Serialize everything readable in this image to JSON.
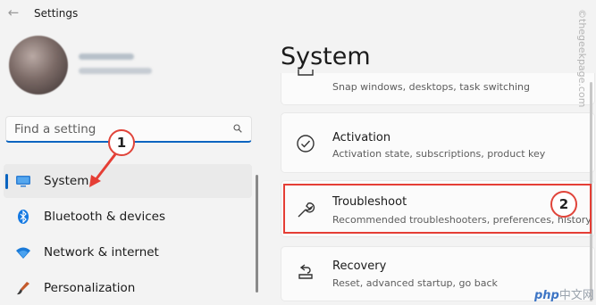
{
  "window": {
    "title": "Settings"
  },
  "search": {
    "placeholder": "Find a setting"
  },
  "nav": [
    {
      "label": "System",
      "icon": "system-monitor-icon",
      "selected": true
    },
    {
      "label": "Bluetooth & devices",
      "icon": "bluetooth-icon"
    },
    {
      "label": "Network & internet",
      "icon": "wifi-icon"
    },
    {
      "label": "Personalization",
      "icon": "paintbrush-icon"
    }
  ],
  "main": {
    "heading": "System",
    "cards": [
      {
        "title": "",
        "desc": "Snap windows, desktops, task switching",
        "icon": "multitasking-icon"
      },
      {
        "title": "Activation",
        "desc": "Activation state, subscriptions, product key",
        "icon": "checkmark-circle-icon"
      },
      {
        "title": "Troubleshoot",
        "desc": "Recommended troubleshooters, preferences, history",
        "icon": "wrench-icon"
      },
      {
        "title": "Recovery",
        "desc": "Reset, advanced startup, go back",
        "icon": "recovery-icon"
      }
    ]
  },
  "annotations": {
    "step1": "1",
    "step2": "2"
  },
  "watermark": "©thegeekpage.com",
  "logo": {
    "brand": "php",
    "suffix": "中文网"
  },
  "colors": {
    "accent": "#0a64c0",
    "annotation": "#e53e35"
  }
}
